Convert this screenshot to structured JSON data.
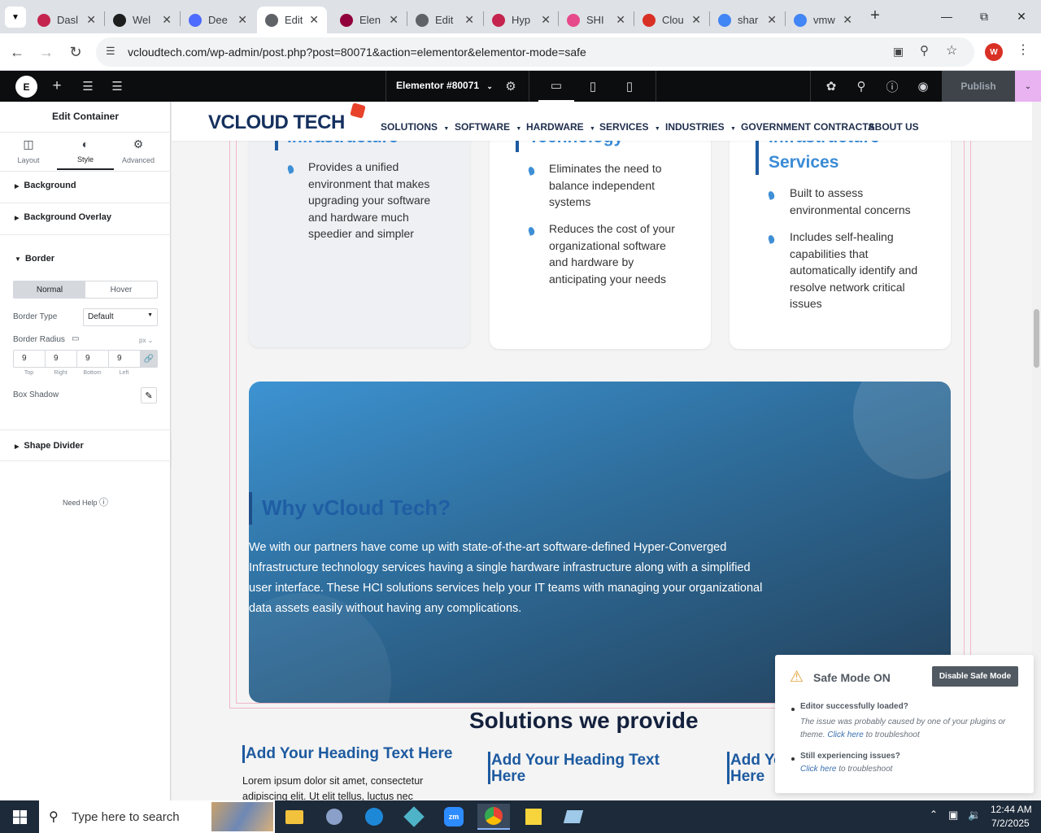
{
  "browser": {
    "tabs": [
      {
        "label": "Dasl",
        "icon": "yoast-icon"
      },
      {
        "label": "Wel",
        "icon": "wordpress-icon"
      },
      {
        "label": "Dee",
        "icon": "deepseek-icon"
      },
      {
        "label": "Edit",
        "icon": "globe-icon"
      },
      {
        "label": "Elen",
        "icon": "elementor-icon"
      },
      {
        "label": "Edit",
        "icon": "globe-icon"
      },
      {
        "label": "Hyp",
        "icon": "yoast-icon"
      },
      {
        "label": "SHI",
        "icon": "shi-icon"
      },
      {
        "label": "Clou",
        "icon": "cloud-icon"
      },
      {
        "label": "shar",
        "icon": "google-icon"
      },
      {
        "label": "vmw",
        "icon": "google-icon"
      }
    ],
    "url": "vcloudtech.com/wp-admin/post.php?post=80071&action=elementor&elementor-mode=safe",
    "profile_initial": "W"
  },
  "elementor_bar": {
    "doc_title": "Elementor #80071",
    "publish_label": "Publish"
  },
  "panel": {
    "title": "Edit Container",
    "tabs": [
      "Layout",
      "Style",
      "Advanced"
    ],
    "sections": {
      "background": "Background",
      "background_overlay": "Background Overlay",
      "border": "Border",
      "shape_divider": "Shape Divider"
    },
    "border_states": [
      "Normal",
      "Hover"
    ],
    "border_type_label": "Border Type",
    "border_type_value": "Default",
    "border_radius_label": "Border Radius",
    "unit": "px",
    "radius_values": [
      "9",
      "9",
      "9",
      "9"
    ],
    "radius_labels": [
      "Top",
      "Right",
      "Bottom",
      "Left"
    ],
    "box_shadow_label": "Box Shadow",
    "need_help": "Need Help"
  },
  "site": {
    "logo": "VCLOUD TECH",
    "nav": [
      "SOLUTIONS",
      "SOFTWARE",
      "HARDWARE",
      "SERVICES",
      "INDUSTRIES",
      "GOVERNMENT CONTRACTS",
      "ABOUT US"
    ],
    "cards": [
      {
        "heading_fragment": "Infrastructure",
        "bullets": [
          "Provides a unified environment that makes upgrading your software and hardware much speedier and simpler"
        ]
      },
      {
        "heading_fragment": "Technology",
        "bullets": [
          "Eliminates the need to balance independent systems",
          "Reduces the cost of your organizational software and hardware by anticipating your needs"
        ]
      },
      {
        "heading_fragment": "Infrastructure",
        "heading_line2": "Services",
        "bullets": [
          "Built to assess environmental concerns",
          "Includes self-healing capabilities that automatically identify and resolve network critical issues"
        ]
      }
    ],
    "why_heading": "Why vCloud Tech?",
    "why_text": "We with our partners have come up with state-of-the-art software-defined Hyper-Converged Infrastructure technology services having a single hardware infrastructure along with a simplified user interface. These HCI solutions services help your IT teams with managing your organizational data assets easily without having any complications.",
    "solutions_heading": "Solutions we provide",
    "add_heading": "Add Your Heading Text Here",
    "lorem_line1": "Lorem ipsum dolor sit amet, consectetur",
    "lorem_line2": "adipiscing elit. Ut elit tellus, luctus nec"
  },
  "safe_mode": {
    "title": "Safe Mode ON",
    "disable_label": "Disable Safe Mode",
    "item1_title": "Editor successfully loaded?",
    "item1_text_a": "The issue was probably caused by one of your plugins or theme.",
    "click_here": "Click here",
    "item1_text_b": "to troubleshoot",
    "item2_title": "Still experiencing issues?",
    "item2_text_b": "to troubleshoot"
  },
  "taskbar": {
    "search_placeholder": "Type here to search",
    "time": "12:44 AM",
    "date": "7/2/2025"
  }
}
